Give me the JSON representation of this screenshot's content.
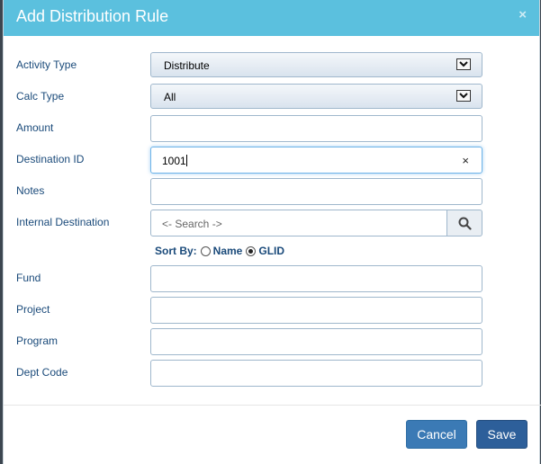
{
  "dialog": {
    "title": "Add Distribution Rule",
    "close_glyph": "×"
  },
  "fields": {
    "activity_type": {
      "label": "Activity Type",
      "value": "Distribute"
    },
    "calc_type": {
      "label": "Calc Type",
      "value": "All"
    },
    "amount": {
      "label": "Amount",
      "value": ""
    },
    "destination_id": {
      "label": "Destination ID",
      "value": "1001",
      "clear_glyph": "×"
    },
    "notes": {
      "label": "Notes",
      "value": ""
    },
    "internal_destination": {
      "label": "Internal Destination",
      "placeholder": "<- Search ->"
    },
    "fund": {
      "label": "Fund",
      "value": ""
    },
    "project": {
      "label": "Project",
      "value": ""
    },
    "program": {
      "label": "Program",
      "value": ""
    },
    "dept_code": {
      "label": "Dept Code",
      "value": ""
    }
  },
  "sort_by": {
    "label": "Sort By:",
    "options": [
      {
        "label": "Name",
        "checked": false
      },
      {
        "label": "GLID",
        "checked": true
      }
    ]
  },
  "footer": {
    "cancel_label": "Cancel",
    "save_label": "Save"
  },
  "colors": {
    "header_bg": "#5bc0de",
    "label_text": "#1a4a7a",
    "primary_button": "#3b7ab5",
    "save_button": "#2d5f9a"
  },
  "icons": {
    "close": "close-icon",
    "select_arrow": "chevron-down-icon",
    "clear": "clear-icon",
    "search": "search-icon"
  }
}
